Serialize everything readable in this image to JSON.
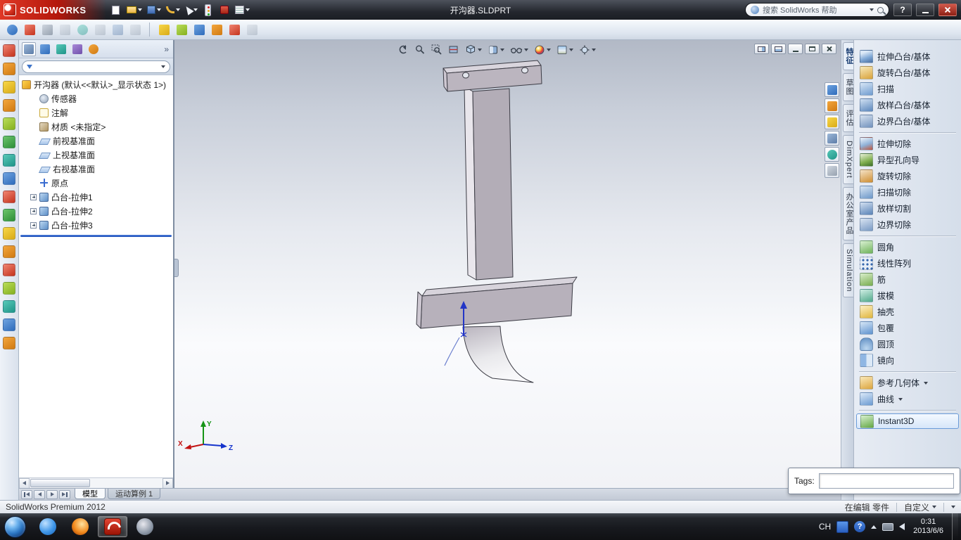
{
  "glyphs": {
    "help": "?",
    "chevron_double": "»"
  },
  "colors": {
    "logo_red": "#c8271b",
    "selection_blue": "#6a9bd8",
    "rollback_blue": "#1e4fb8",
    "taskbar_dark": "#17191e"
  },
  "titlebar": {
    "brand": "SOLIDWORKS",
    "document_title": "开沟器.SLDPRT",
    "search_placeholder": "搜索 SolidWorks 帮助"
  },
  "feature_manager": {
    "root_label": "开沟器 (默认<<默认>_显示状态 1>)",
    "items": [
      {
        "label": "传感器"
      },
      {
        "label": "注解"
      },
      {
        "label": "材质 <未指定>"
      },
      {
        "label": "前视基准面"
      },
      {
        "label": "上视基准面"
      },
      {
        "label": "右视基准面"
      },
      {
        "label": "原点"
      },
      {
        "label": "凸台-拉伸1"
      },
      {
        "label": "凸台-拉伸2"
      },
      {
        "label": "凸台-拉伸3"
      }
    ]
  },
  "command_manager_tabs": [
    {
      "label": "特征"
    },
    {
      "label": "草图"
    },
    {
      "label": "评估"
    },
    {
      "label": "DimXpert"
    },
    {
      "label": "办公室产品"
    },
    {
      "label": "Simulation"
    }
  ],
  "features_panel": {
    "items": [
      {
        "label": "拉伸凸台/基体"
      },
      {
        "label": "旋转凸台/基体"
      },
      {
        "label": "扫描"
      },
      {
        "label": "放样凸台/基体"
      },
      {
        "label": "边界凸台/基体"
      },
      {
        "label": "拉伸切除"
      },
      {
        "label": "异型孔向导"
      },
      {
        "label": "旋转切除"
      },
      {
        "label": "扫描切除"
      },
      {
        "label": "放样切割"
      },
      {
        "label": "边界切除"
      },
      {
        "label": "圆角"
      },
      {
        "label": "线性阵列"
      },
      {
        "label": "筋"
      },
      {
        "label": "拔模"
      },
      {
        "label": "抽壳"
      },
      {
        "label": "包覆"
      },
      {
        "label": "圆顶"
      },
      {
        "label": "镜向"
      },
      {
        "label": "参考几何体"
      },
      {
        "label": "曲线"
      },
      {
        "label": "Instant3D"
      }
    ]
  },
  "viewport": {
    "triad": {
      "x": "X",
      "y": "Y",
      "z": "Z"
    },
    "tags_label": "Tags:"
  },
  "bottom_tabs": {
    "model": "模型",
    "motion_study": "运动算例 1"
  },
  "statusbar": {
    "product": "SolidWorks Premium 2012",
    "editing_status": "在编辑 零件",
    "custom": "自定义"
  },
  "taskbar": {
    "language": "CH",
    "time": "0:31",
    "date": "2013/6/6"
  }
}
